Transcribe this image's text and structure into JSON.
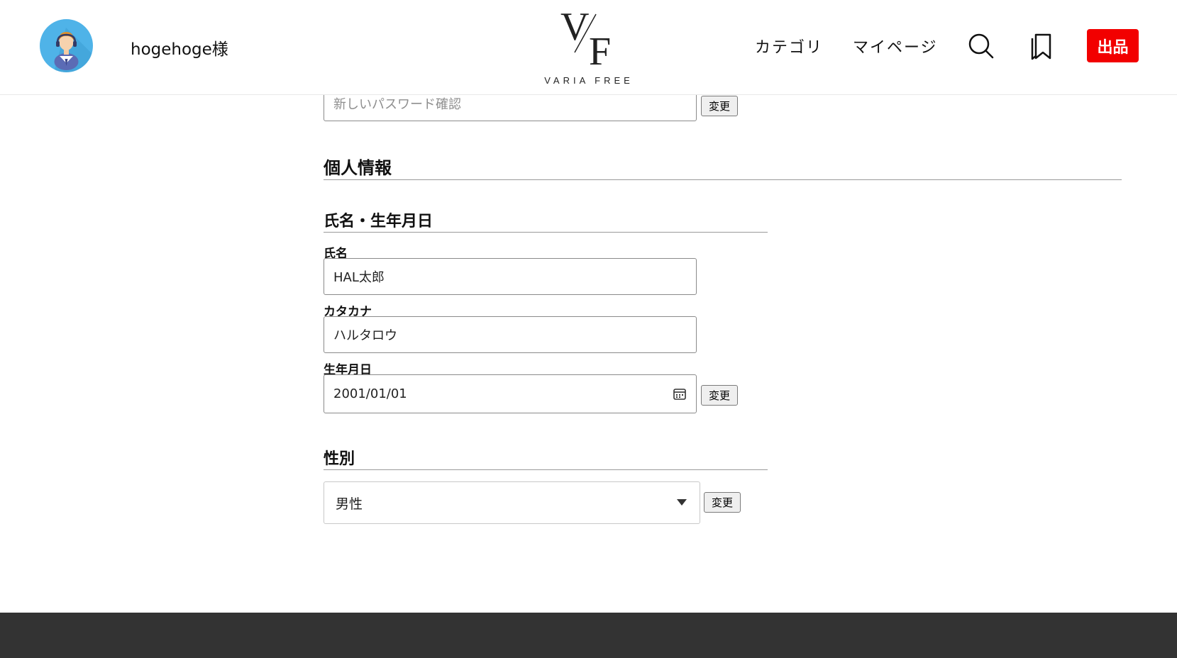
{
  "header": {
    "username": "hogehoge様",
    "logo_text": "VARIA FREE",
    "logo_mark_v": "V",
    "logo_mark_f": "F",
    "nav": {
      "category": "カテゴリ",
      "mypage": "マイページ"
    },
    "sell_label": "出品",
    "icons": {
      "avatar": "user-avatar-icon",
      "search": "search-icon",
      "bookmark": "bookmark-icon"
    }
  },
  "password": {
    "confirm_placeholder": "新しいパスワード確認",
    "change_label": "変更"
  },
  "personal": {
    "section_title": "個人情報",
    "name_dob": {
      "title": "氏名・生年月日",
      "name_label": "氏名",
      "name_value": "HAL太郎",
      "kana_label": "カタカナ",
      "kana_value": "ハルタロウ",
      "dob_label": "生年月日",
      "dob_value": "2001/01/01",
      "change_label": "変更"
    },
    "gender": {
      "title": "性別",
      "selected": "男性",
      "change_label": "変更"
    }
  },
  "colors": {
    "sell_button": "#f20000",
    "footer": "#333333",
    "avatar_bg": "#4fb3e8"
  }
}
